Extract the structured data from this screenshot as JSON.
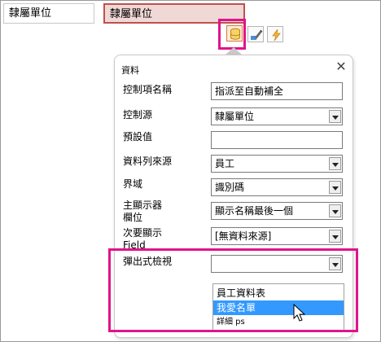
{
  "top_bar": {
    "label_cell": "隸屬單位",
    "control_cell": "隸屬單位"
  },
  "toolbar": {
    "buttons": [
      {
        "name": "data-icon",
        "active": true
      },
      {
        "name": "format-icon",
        "active": false
      },
      {
        "name": "event-icon",
        "active": false
      }
    ]
  },
  "panel": {
    "title": "資料",
    "close_glyph": "✕",
    "properties": [
      {
        "label": "控制項名稱",
        "value": "指派至自動補全",
        "combo": false
      },
      {
        "label": "控制源",
        "value": "隸屬單位",
        "combo": true
      },
      {
        "label": "預設值",
        "value": "",
        "combo": false
      },
      {
        "label": "資料列來源",
        "value": "員工",
        "combo": true
      },
      {
        "label": "界域",
        "value": "識別碼",
        "combo": true
      },
      {
        "label": "主顯示器\n欄位",
        "value": "顯示名稱最後一個",
        "combo": true
      },
      {
        "label": "次要顯示\nField",
        "value": "[無資料來源]",
        "combo": true
      },
      {
        "label": "彈出式檢視",
        "value": "",
        "combo": true
      }
    ],
    "popup_options": [
      "員工資料表",
      "我愛名單",
      "詳細 ps"
    ],
    "popup_selected_index": 1
  },
  "colors": {
    "highlight_border": "#e0148a",
    "selected_option": "#3399ff",
    "control_accent": "#c0504d"
  }
}
